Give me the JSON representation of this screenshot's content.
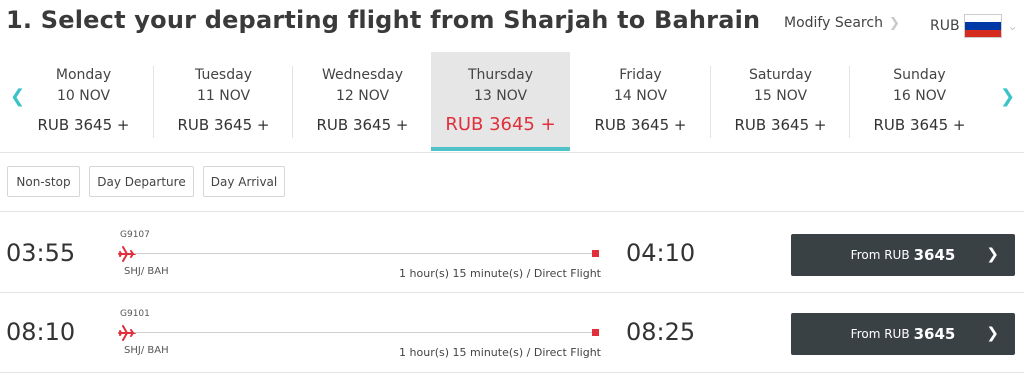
{
  "header": {
    "title": "1. Select your departing flight from Sharjah to Bahrain",
    "modify_label": "Modify Search",
    "currency_label": "RUB",
    "flag_colors": [
      "#ffffff",
      "#0039a6",
      "#d52b1e"
    ]
  },
  "date_nav": {
    "prev_icon": "chevron-left-icon",
    "next_icon": "chevron-right-icon",
    "accent_color": "#4fc3c7",
    "days": [
      {
        "day": "Monday",
        "date": "10 NOV",
        "price": "RUB 3645 +"
      },
      {
        "day": "Tuesday",
        "date": "11 NOV",
        "price": "RUB 3645 +"
      },
      {
        "day": "Wednesday",
        "date": "12 NOV",
        "price": "RUB 3645 +"
      },
      {
        "day": "Thursday",
        "date": "13 NOV",
        "price": "RUB 3645 +",
        "selected": true
      },
      {
        "day": "Friday",
        "date": "14 NOV",
        "price": "RUB 3645 +"
      },
      {
        "day": "Saturday",
        "date": "15 NOV",
        "price": "RUB 3645 +"
      },
      {
        "day": "Sunday",
        "date": "16 NOV",
        "price": "RUB 3645 +"
      }
    ]
  },
  "filters": [
    "Non-stop",
    "Day Departure",
    "Day Arrival"
  ],
  "flights": [
    {
      "departure": "03:55",
      "arrival": "04:10",
      "flight_no": "G9107",
      "route": "SHJ/ BAH",
      "duration": "1 hour(s) 15 minute(s) / Direct Flight",
      "button_prefix": "From RUB",
      "button_amount": "3645"
    },
    {
      "departure": "08:10",
      "arrival": "08:25",
      "flight_no": "G9101",
      "route": "SHJ/ BAH",
      "duration": "1 hour(s) 15 minute(s) / Direct Flight",
      "button_prefix": "From RUB",
      "button_amount": "3645"
    }
  ],
  "colors": {
    "price_highlight": "#e0303c",
    "button_bg": "#3a4145",
    "plane": "#e0303c"
  }
}
